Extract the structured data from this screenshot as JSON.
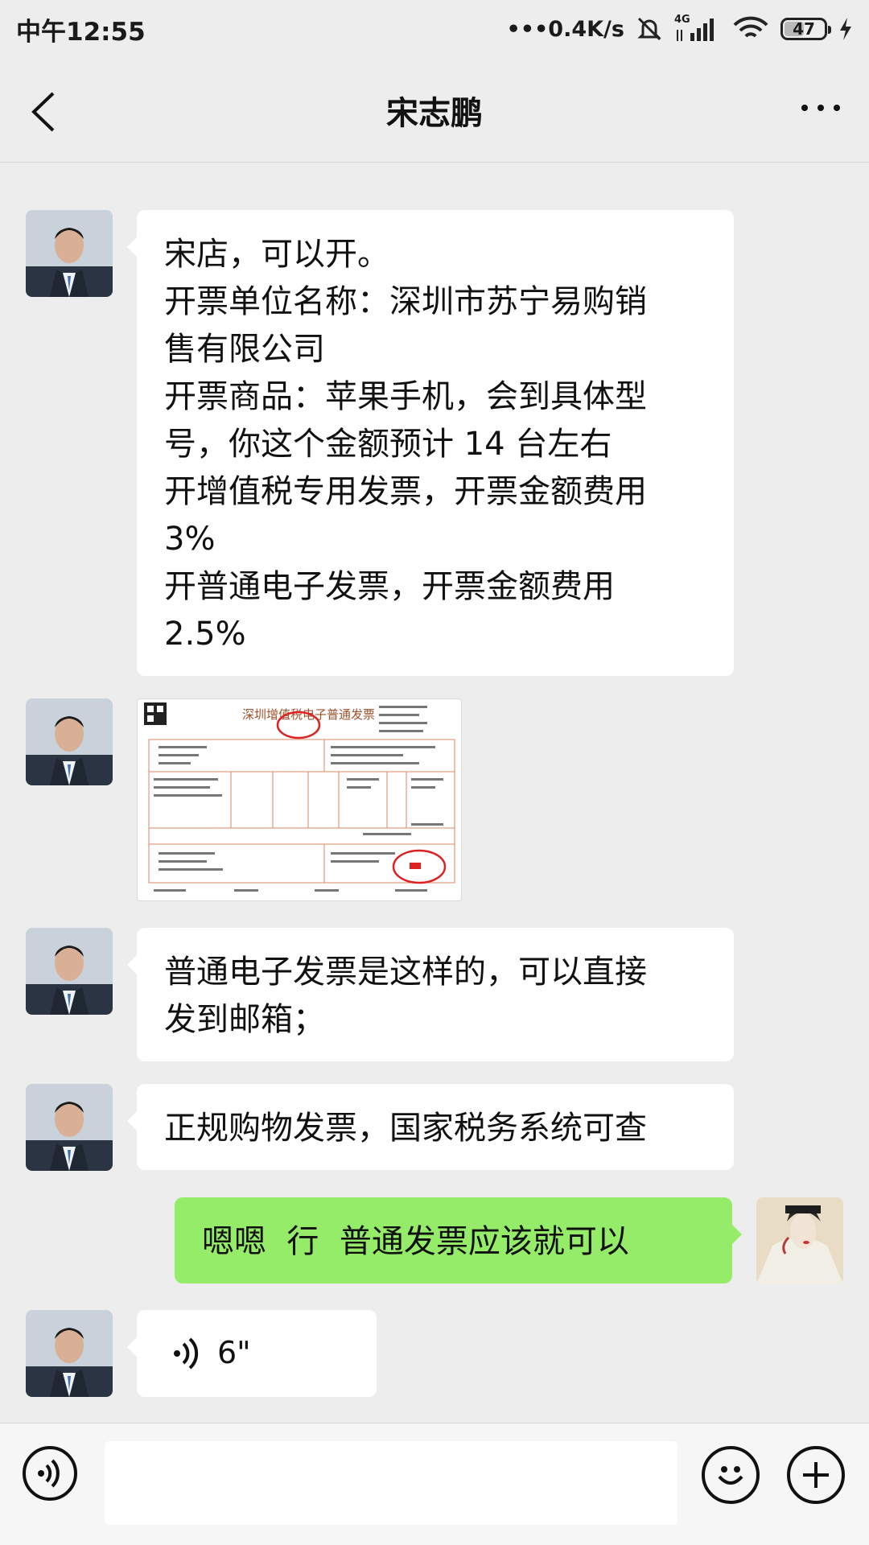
{
  "status": {
    "time": "中午12:55",
    "speed": "•••0.4K/s",
    "network": "4G",
    "battery": "47",
    "battery_level": 0.47
  },
  "header": {
    "title": "宋志鹏"
  },
  "messages": {
    "m1": {
      "lines": [
        "宋店，可以开。",
        "开票单位名称：深圳市苏宁易购销",
        "售有限公司",
        "开票商品：苹果手机，会到具体型",
        "号，你这个金额预计 14 台左右",
        "开增值税专用发票，开票金额费用",
        "3%",
        "开普通电子发票，开票金额费用",
        "2.5%"
      ]
    },
    "m3": {
      "lines": [
        "普通电子发票是这样的，可以直接",
        "发到邮箱；"
      ]
    },
    "m4": {
      "lines": [
        "正规购物发票，国家税务系统可查"
      ]
    },
    "m5": {
      "lines": [
        "嗯嗯  行  普通发票应该就可以"
      ]
    },
    "m6": {
      "duration": "6\""
    }
  },
  "invoice_image": {
    "title": "深圳增值税电子普通发票"
  },
  "input": {
    "placeholder": ""
  },
  "icons": [
    "back-arrow-icon",
    "more-icon",
    "voice-icon",
    "emoji-icon",
    "plus-icon",
    "mute-icon",
    "wifi-icon",
    "charging-icon"
  ]
}
